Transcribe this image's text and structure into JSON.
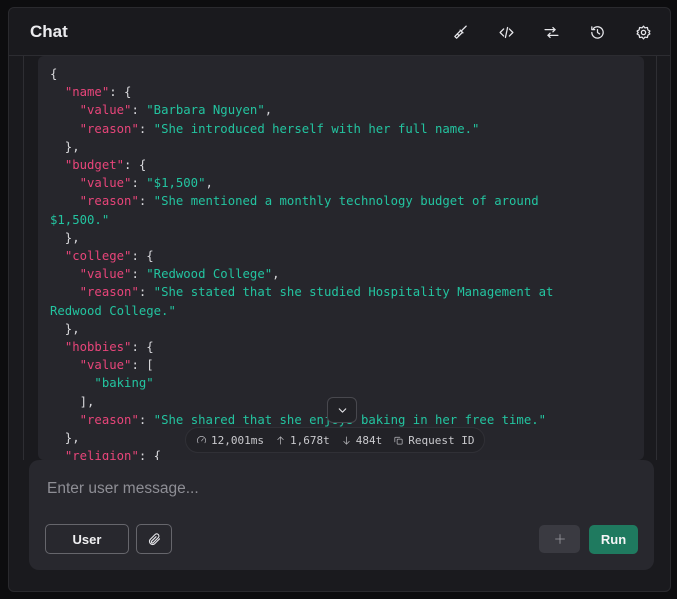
{
  "header": {
    "title": "Chat",
    "icons": [
      "broom-icon",
      "code-icon",
      "compare-arrows-icon",
      "history-icon",
      "settings-gear-icon"
    ]
  },
  "response_json": {
    "lines": [
      [
        {
          "t": "p",
          "v": "{"
        }
      ],
      [
        {
          "t": "p",
          "v": "  "
        },
        {
          "t": "k",
          "v": "\"name\""
        },
        {
          "t": "p",
          "v": ": {"
        }
      ],
      [
        {
          "t": "p",
          "v": "    "
        },
        {
          "t": "k",
          "v": "\"value\""
        },
        {
          "t": "p",
          "v": ": "
        },
        {
          "t": "s",
          "v": "\"Barbara Nguyen\""
        },
        {
          "t": "p",
          "v": ","
        }
      ],
      [
        {
          "t": "p",
          "v": "    "
        },
        {
          "t": "k",
          "v": "\"reason\""
        },
        {
          "t": "p",
          "v": ": "
        },
        {
          "t": "s",
          "v": "\"She introduced herself with her full name.\""
        }
      ],
      [
        {
          "t": "p",
          "v": "  },"
        }
      ],
      [
        {
          "t": "p",
          "v": "  "
        },
        {
          "t": "k",
          "v": "\"budget\""
        },
        {
          "t": "p",
          "v": ": {"
        }
      ],
      [
        {
          "t": "p",
          "v": "    "
        },
        {
          "t": "k",
          "v": "\"value\""
        },
        {
          "t": "p",
          "v": ": "
        },
        {
          "t": "s",
          "v": "\"$1,500\""
        },
        {
          "t": "p",
          "v": ","
        }
      ],
      [
        {
          "t": "p",
          "v": "    "
        },
        {
          "t": "k",
          "v": "\"reason\""
        },
        {
          "t": "p",
          "v": ": "
        },
        {
          "t": "s",
          "v": "\"She mentioned a monthly technology budget of around"
        }
      ],
      [
        {
          "t": "s",
          "v": "$1,500.\""
        }
      ],
      [
        {
          "t": "p",
          "v": "  },"
        }
      ],
      [
        {
          "t": "p",
          "v": "  "
        },
        {
          "t": "k",
          "v": "\"college\""
        },
        {
          "t": "p",
          "v": ": {"
        }
      ],
      [
        {
          "t": "p",
          "v": "    "
        },
        {
          "t": "k",
          "v": "\"value\""
        },
        {
          "t": "p",
          "v": ": "
        },
        {
          "t": "s",
          "v": "\"Redwood College\""
        },
        {
          "t": "p",
          "v": ","
        }
      ],
      [
        {
          "t": "p",
          "v": "    "
        },
        {
          "t": "k",
          "v": "\"reason\""
        },
        {
          "t": "p",
          "v": ": "
        },
        {
          "t": "s",
          "v": "\"She stated that she studied Hospitality Management at"
        }
      ],
      [
        {
          "t": "s",
          "v": "Redwood College.\""
        }
      ],
      [
        {
          "t": "p",
          "v": "  },"
        }
      ],
      [
        {
          "t": "p",
          "v": "  "
        },
        {
          "t": "k",
          "v": "\"hobbies\""
        },
        {
          "t": "p",
          "v": ": {"
        }
      ],
      [
        {
          "t": "p",
          "v": "    "
        },
        {
          "t": "k",
          "v": "\"value\""
        },
        {
          "t": "p",
          "v": ": ["
        }
      ],
      [
        {
          "t": "p",
          "v": "      "
        },
        {
          "t": "s",
          "v": "\"baking\""
        }
      ],
      [
        {
          "t": "p",
          "v": "    ],"
        }
      ],
      [
        {
          "t": "p",
          "v": "    "
        },
        {
          "t": "k",
          "v": "\"reason\""
        },
        {
          "t": "p",
          "v": ": "
        },
        {
          "t": "s",
          "v": "\"She shared that she enjoys baking in her free time.\""
        }
      ],
      [
        {
          "t": "p",
          "v": "  },"
        }
      ],
      [
        {
          "t": "p",
          "v": "  "
        },
        {
          "t": "k",
          "v": "\"religion\""
        },
        {
          "t": "p",
          "v": ": {"
        }
      ]
    ]
  },
  "stats": {
    "latency": "12,001ms",
    "tokens_in": "1,678t",
    "tokens_out": "484t",
    "request_id_label": "Request ID"
  },
  "composer": {
    "placeholder": "Enter user message...",
    "role_button": "User",
    "run_button": "Run"
  },
  "colors": {
    "key": "#e8457a",
    "string": "#23c4a0",
    "run_button": "#1f7a5f",
    "background": "#1a1a1e"
  }
}
